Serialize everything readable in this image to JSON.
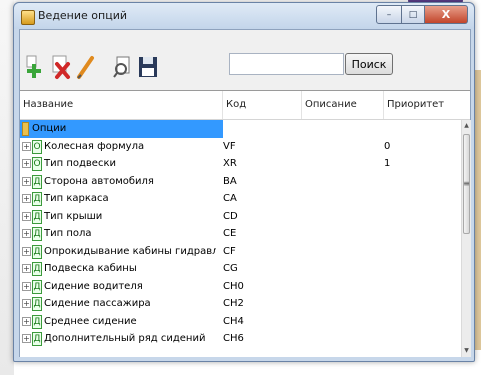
{
  "window": {
    "title": "Ведение опций",
    "buttons": {
      "minimize": "–",
      "maximize": "□",
      "close": "X"
    }
  },
  "toolbar": {
    "tools": [
      {
        "icon": "add-icon",
        "color": "#3aa53a"
      },
      {
        "icon": "delete-icon",
        "color": "#d02828"
      },
      {
        "icon": "edit-icon",
        "color": "#e08a1e"
      },
      {
        "icon": "search-tool-icon",
        "color": "#555555"
      },
      {
        "icon": "save-icon",
        "color": "#2a3a5a"
      }
    ],
    "search_value": "",
    "search_button": "Поиск"
  },
  "grid": {
    "columns": [
      "Название",
      "Код",
      "Описание",
      "Приоритет"
    ],
    "selected_color": "#3399ff",
    "rows": [
      {
        "name": "Опции",
        "code": "",
        "desc": "",
        "prio": "",
        "root": true
      },
      {
        "expander": "+",
        "badge": "О",
        "name": "Колесная формула",
        "code": "VF",
        "desc": "",
        "prio": "0"
      },
      {
        "expander": "+",
        "badge": "О",
        "name": "Тип подвески",
        "code": "XR",
        "desc": "",
        "prio": "1"
      },
      {
        "expander": "+",
        "badge": "Д",
        "name": "Сторона автомобиля",
        "code": "BA",
        "desc": "",
        "prio": ""
      },
      {
        "expander": "+",
        "badge": "Д",
        "name": "Тип каркаса",
        "code": "CA",
        "desc": "",
        "prio": ""
      },
      {
        "expander": "+",
        "badge": "Д",
        "name": "Тип крыши",
        "code": "CD",
        "desc": "",
        "prio": ""
      },
      {
        "expander": "+",
        "badge": "Д",
        "name": "Тип пола",
        "code": "CE",
        "desc": "",
        "prio": ""
      },
      {
        "expander": "+",
        "badge": "Д",
        "name": "Опрокидывание  кабины гидравлическим домк",
        "code": "CF",
        "desc": "",
        "prio": ""
      },
      {
        "expander": "+",
        "badge": "Д",
        "name": "Подвеска кабины",
        "code": "CG",
        "desc": "",
        "prio": ""
      },
      {
        "expander": "+",
        "badge": "Д",
        "name": "Сидение водителя",
        "code": "CH0",
        "desc": "",
        "prio": ""
      },
      {
        "expander": "+",
        "badge": "Д",
        "name": "Сидение пассажира",
        "code": "CH2",
        "desc": "",
        "prio": ""
      },
      {
        "expander": "+",
        "badge": "Д",
        "name": "Среднее сидение",
        "code": "CH4",
        "desc": "",
        "prio": ""
      },
      {
        "expander": "+",
        "badge": "Д",
        "name": "Дополнительный ряд сидений",
        "code": "CH6",
        "desc": "",
        "prio": ""
      }
    ]
  },
  "scrollbar": {
    "up": "▲",
    "down": "▼",
    "grip": "≡"
  }
}
